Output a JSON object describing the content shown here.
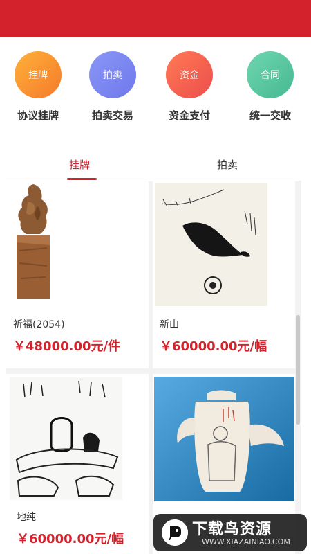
{
  "quick_actions": [
    {
      "circle_label": "挂牌",
      "caption": "协议挂牌",
      "color": "#f5902f"
    },
    {
      "circle_label": "拍卖",
      "caption": "拍卖交易",
      "color": "#7c87f2"
    },
    {
      "circle_label": "资金",
      "caption": "资金支付",
      "color": "#f0614f"
    },
    {
      "circle_label": "合同",
      "caption": "统一交收",
      "color": "#57c6a1"
    }
  ],
  "tabs": [
    {
      "label": "挂牌",
      "active": true
    },
    {
      "label": "拍卖",
      "active": false
    }
  ],
  "products": [
    {
      "title": "祈福(2054)",
      "price": "￥48000.00元/件"
    },
    {
      "title": "新山",
      "price": "￥60000.00元/幅"
    },
    {
      "title": "地纯",
      "price": "￥60000.00元/幅"
    },
    {
      "title": "",
      "price": ""
    }
  ],
  "watermark": {
    "main": "下载鸟资源",
    "sub": "WWW.XIAZAINIAO.COM"
  },
  "colors": {
    "brand": "#d4222c",
    "price": "#d4222c"
  }
}
